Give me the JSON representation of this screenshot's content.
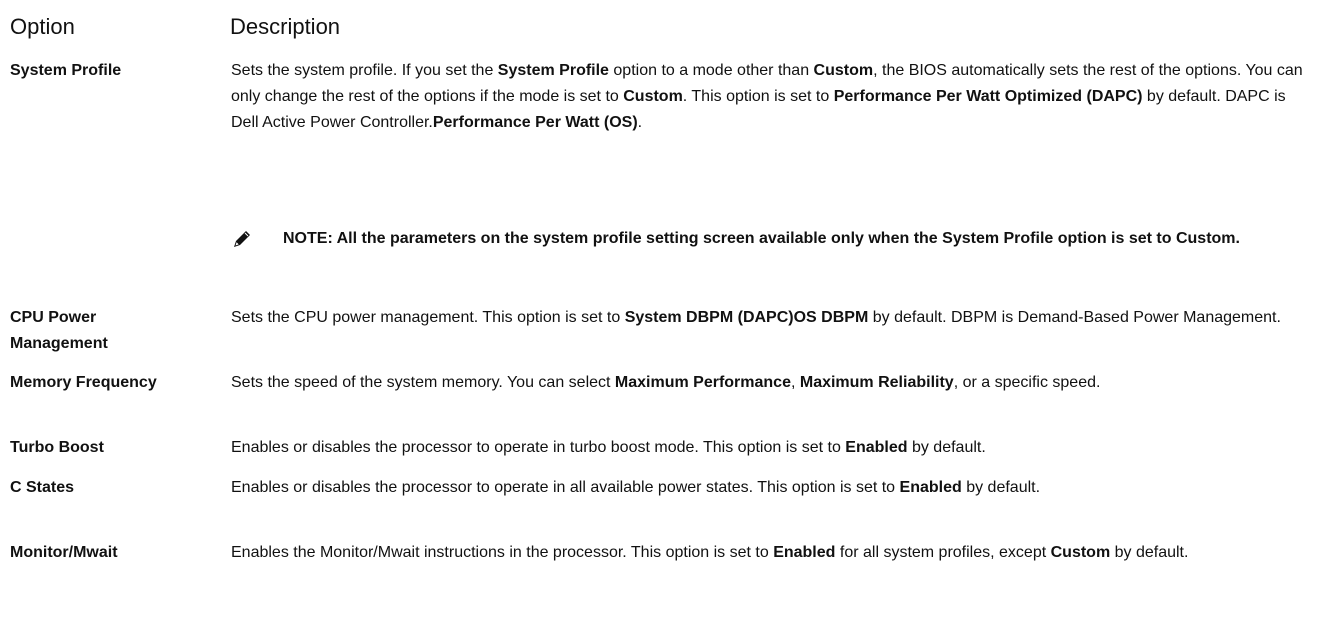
{
  "header": {
    "option": "Option",
    "description": "Description"
  },
  "rows": [
    {
      "name": "System Profile",
      "segments": [
        {
          "t": "Sets the system profile. If you set the "
        },
        {
          "t": "System Profile",
          "b": true
        },
        {
          "t": " option to a mode other than "
        },
        {
          "t": "Custom",
          "b": true
        },
        {
          "t": ", the BIOS automatically sets the rest of the options. You can only change the rest of the options if the mode is set to "
        },
        {
          "t": "Custom",
          "b": true
        },
        {
          "t": ". This option is set to "
        },
        {
          "t": "Performance Per Watt Optimized (DAPC)",
          "b": true
        },
        {
          "t": " by default. DAPC is Dell Active Power Controller."
        },
        {
          "t": "Performance Per Watt (OS)",
          "b": true
        },
        {
          "t": "."
        }
      ]
    },
    {
      "name": "CPU Power Management",
      "segments": [
        {
          "t": "Sets the CPU power management. This option is set to "
        },
        {
          "t": "System DBPM (DAPC)OS DBPM",
          "b": true
        },
        {
          "t": " by default. DBPM is Demand-Based Power Management."
        }
      ]
    },
    {
      "name": "Memory Frequency",
      "segments": [
        {
          "t": "Sets the speed of the system memory. You can select "
        },
        {
          "t": "Maximum Performance",
          "b": true
        },
        {
          "t": ", "
        },
        {
          "t": "Maximum Reliability",
          "b": true
        },
        {
          "t": ", or a specific speed."
        }
      ]
    },
    {
      "name": "Turbo Boost",
      "segments": [
        {
          "t": "Enables or disables the processor to operate in turbo boost mode. This option is set to "
        },
        {
          "t": "Enabled",
          "b": true
        },
        {
          "t": " by default."
        }
      ]
    },
    {
      "name": "C States",
      "segments": [
        {
          "t": "Enables or disables the processor to operate in all available power states. This option is set to "
        },
        {
          "t": "Enabled",
          "b": true
        },
        {
          "t": " by default."
        }
      ]
    },
    {
      "name": "Monitor/Mwait",
      "segments": [
        {
          "t": "Enables the Monitor/Mwait instructions in the processor. This option is set to "
        },
        {
          "t": "Enabled",
          "b": true
        },
        {
          "t": " for all system profiles, except "
        },
        {
          "t": "Custom",
          "b": true
        },
        {
          "t": " by default."
        }
      ]
    }
  ],
  "note": {
    "icon": "pencil-note-icon",
    "text": "NOTE: All the parameters on the system profile setting screen available only when the System Profile option is set to Custom."
  }
}
